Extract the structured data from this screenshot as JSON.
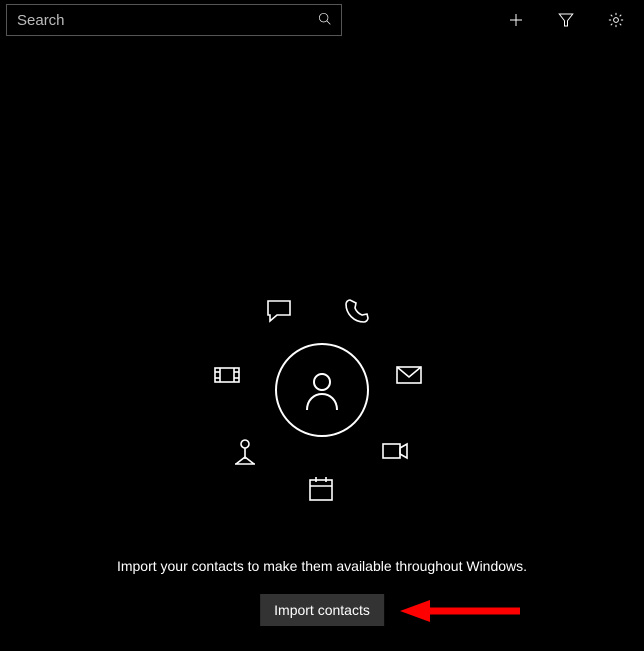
{
  "search": {
    "placeholder": "Search"
  },
  "message": "Import your contacts to make them available throughout Windows.",
  "import_button": "Import contacts"
}
